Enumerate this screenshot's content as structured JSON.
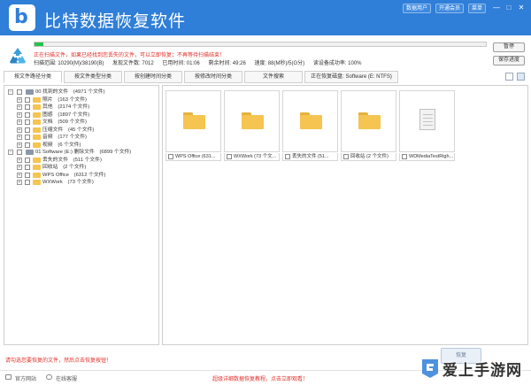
{
  "titlebar": {
    "title": "比特数据恢复软件",
    "buttons": [
      "数据用户",
      "开通会员",
      "菜单"
    ],
    "controls": [
      "—",
      "□",
      "✕"
    ],
    "logo_icon": "bitdata-logo-icon"
  },
  "status": {
    "progress_percent": 2,
    "warning": "正在扫描文件，如果已经找到您丢失的文件，可以立即恢复；不再等待扫描结束！",
    "stats": [
      "扫描范围: 10290(M)/38190(B)",
      "发现文件数: 7012",
      "已用时间: 01:06",
      "剩余时间: 49:26",
      "速度: 88(M秒)/5(G分)",
      "读设备成功率: 100%"
    ],
    "pause_label": "暂停",
    "save_progress_label": "保存进度"
  },
  "tabs": [
    {
      "label": "按文件路径分类",
      "active": true
    },
    {
      "label": "按文件类型分类",
      "active": false
    },
    {
      "label": "按创建时间分类",
      "active": false
    },
    {
      "label": "按修改时间分类",
      "active": false
    },
    {
      "label": "文件搜索",
      "active": false
    },
    {
      "label": "正在恢复磁盘: Software (E: NTFS)",
      "active": false
    }
  ],
  "tree": [
    {
      "label": "00 找到的文件　(4971 个文件)",
      "level": 0,
      "expander": "−",
      "icon": "drive-icon"
    },
    {
      "label": "照片　(163 个文件)",
      "level": 1,
      "expander": "+",
      "icon": "folder-icon"
    },
    {
      "label": "其他　(2174 个文件)",
      "level": 1,
      "expander": "+",
      "icon": "folder-icon"
    },
    {
      "label": "图感　(1897 个文件)",
      "level": 1,
      "expander": "+",
      "icon": "folder-icon"
    },
    {
      "label": "文档　(509 个文件)",
      "level": 1,
      "expander": "+",
      "icon": "folder-icon"
    },
    {
      "label": "压缩文件　(45 个文件)",
      "level": 1,
      "expander": "+",
      "icon": "folder-icon"
    },
    {
      "label": "音频　(177 个文件)",
      "level": 1,
      "expander": "+",
      "icon": "folder-icon"
    },
    {
      "label": "视频　(6 个文件)",
      "level": 1,
      "expander": "+",
      "icon": "folder-icon"
    },
    {
      "label": "01 Software (E:) 删除文件　(6899 个文件)",
      "level": 0,
      "expander": "−",
      "icon": "drive-icon"
    },
    {
      "label": "丢失的文件　(511 个文件)",
      "level": 1,
      "expander": "+",
      "icon": "folder-icon"
    },
    {
      "label": "回收站　(2 个文件)",
      "level": 1,
      "expander": "+",
      "icon": "folder-icon"
    },
    {
      "label": "WPS Office　(6312 个文件)",
      "level": 1,
      "expander": "+",
      "icon": "folder-icon"
    },
    {
      "label": "WXWork　(73 个文件)",
      "level": 1,
      "expander": "+",
      "icon": "folder-icon"
    }
  ],
  "files": [
    {
      "caption": "WPS Office (631...",
      "icon": "folder-icon"
    },
    {
      "caption": "WXWork (73 个文...",
      "icon": "folder-icon"
    },
    {
      "caption": "丢失的文件 (51...",
      "icon": "folder-icon"
    },
    {
      "caption": "回收站 (2 个文件)",
      "icon": "folder-icon"
    },
    {
      "caption": "WDMediaTestRigh...",
      "icon": "document-icon"
    }
  ],
  "bottom": {
    "hint": "请勾选您要恢复的文件，然后点击恢复按钮！",
    "recover_label": "恢复",
    "footer_left": [
      "官方网站",
      "在线客服"
    ],
    "footer_center": "超级详细数据恢复教程，点击立即观看！",
    "watermark_text": "爱上手游网"
  },
  "colors": {
    "titlebar": "#2f7ed8",
    "progress": "#27c24c",
    "warning": "#e0302a",
    "folder": "#f5c451"
  }
}
